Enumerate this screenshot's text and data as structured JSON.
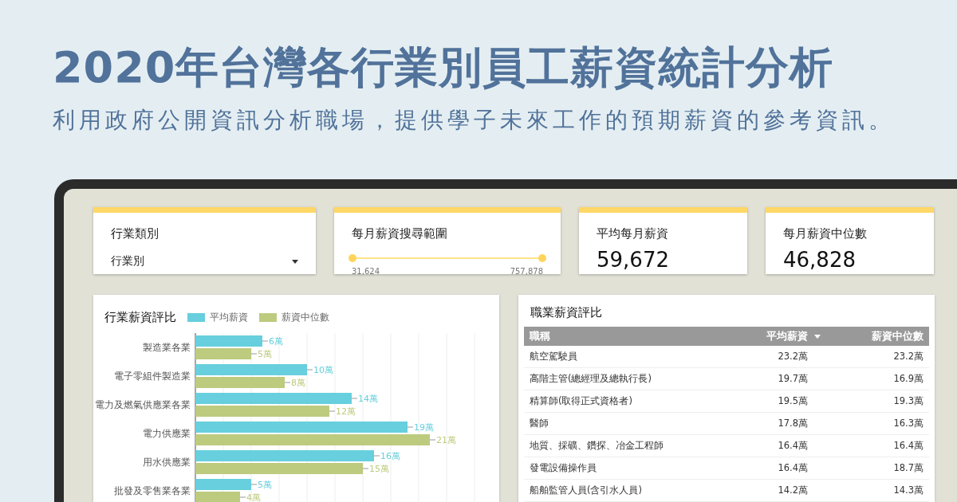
{
  "header": {
    "title": "2020年台灣各行業別員工薪資統計分析",
    "subtitle": "利用政府公開資訊分析職場，提供學子未來工作的預期薪資的參考資訊。"
  },
  "filters": [
    {
      "kind": "dropdown",
      "label": "行業類別",
      "value": "行業別"
    },
    {
      "kind": "range",
      "label": "每月薪資搜尋範圍",
      "min": "31,624",
      "max": "757,878",
      "level": 1
    }
  ],
  "metrics": [
    {
      "label": "平均每月薪資",
      "value": "59,672"
    },
    {
      "label": "每月薪資中位數",
      "value": "46,828"
    }
  ],
  "industry_chart": {
    "title": "行業薪資評比",
    "chart_data": {
      "type": "bar",
      "orientation": "horizontal",
      "categories": [
        "製造業各業",
        "電子零組件製造業",
        "電力及燃氣供應業各業",
        "電力供應業",
        "用水供應業",
        "批發及零售業各業"
      ],
      "series": [
        {
          "name": "平均薪資",
          "color": "#67cfdd",
          "values": [
            6,
            10,
            14,
            19,
            16,
            5
          ],
          "value_labels": [
            "6萬",
            "10萬",
            "14萬",
            "19萬",
            "16萬",
            "5萬"
          ]
        },
        {
          "name": "薪資中位數",
          "color": "#bccb7e",
          "values": [
            5,
            8,
            12,
            21,
            15,
            4
          ],
          "value_labels": [
            "5萬",
            "8萬",
            "12萬",
            "21萬",
            "15萬",
            "4萬"
          ]
        }
      ]
    }
  },
  "occupation_table": {
    "title": "職業薪資評比",
    "columns": [
      {
        "label": "職稱",
        "sorted": false
      },
      {
        "label": "平均薪資",
        "sorted": true
      },
      {
        "label": "薪資中位數",
        "sorted": false
      }
    ],
    "rows": [
      [
        "航空駕駛員",
        "23.2萬",
        "23.2萬"
      ],
      [
        "高階主管(總經理及總執行長)",
        "19.7萬",
        "16.9萬"
      ],
      [
        "精算師(取得正式資格者)",
        "19.5萬",
        "19.3萬"
      ],
      [
        "醫師",
        "17.8萬",
        "16.3萬"
      ],
      [
        "地質、採礦、鑽探、冶金工程師",
        "16.4萬",
        "16.4萬"
      ],
      [
        "發電設備操作員",
        "16.4萬",
        "18.7萬"
      ],
      [
        "船舶監管人員(含引水人員)",
        "14.2萬",
        "14.3萬"
      ]
    ]
  }
}
